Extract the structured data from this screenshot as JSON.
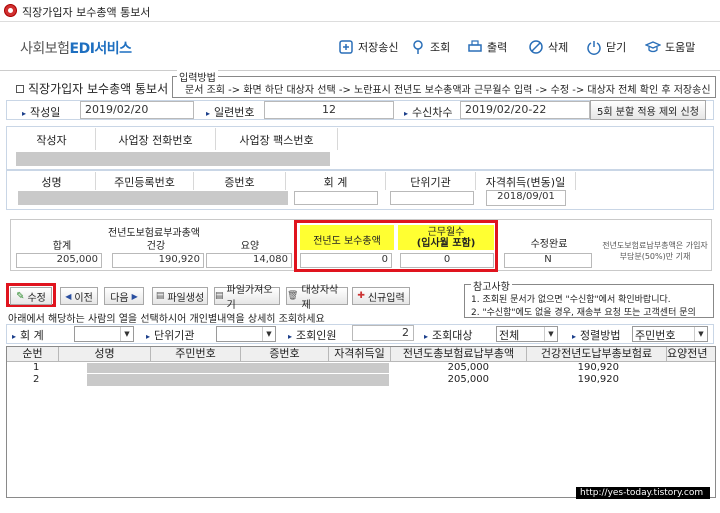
{
  "window": {
    "title": "직장가입자 보수총액 통보서"
  },
  "brand": {
    "name": "사회보험",
    "accent": "EDI서비스"
  },
  "toolbar": [
    {
      "label": "저장송신",
      "icon": "save-send-icon"
    },
    {
      "label": "조회",
      "icon": "location-pin-icon"
    },
    {
      "label": "출력",
      "icon": "printer-icon"
    },
    {
      "label": "삭제",
      "icon": "delete-icon"
    },
    {
      "label": "닫기",
      "icon": "power-icon"
    },
    {
      "label": "도움말",
      "icon": "graduation-cap-icon"
    }
  ],
  "form": {
    "title": "직장가입자 보수총액 통보서",
    "input_method_legend": "입력방법",
    "input_method_text": "문서 조회 -> 화면 하단 대상자 선택 -> 노란표시 전년도 보수총액과 근무월수 입력 -> 수정 -> 대상자 전체 확인 후 저장송신",
    "created_label": "작성일",
    "created_value": "2019/02/20",
    "serial_label": "일련번호",
    "serial_value": "12",
    "receive_label": "수신차수",
    "receive_value": "2019/02/20-22",
    "request_button": "5회 분할 적용 제외 신청"
  },
  "author": {
    "col1": "작성자",
    "col2": "사업장 전화번호",
    "col3": "사업장 팩스번호"
  },
  "person": {
    "name": "성명",
    "rrn": "주민등록번호",
    "cert": "증번호",
    "account": "회 계",
    "unit": "단위기관",
    "acquired": "자격취득(변동)일",
    "acquired_value": "2018/09/01"
  },
  "premium": {
    "title": "전년도보험료부과총액",
    "total_label": "합계",
    "total_value": "205,000",
    "health_label": "건강",
    "health_value": "190,920",
    "care_label": "요양",
    "care_value": "14,080",
    "pay_label": "전년도 보수총액",
    "pay_value": "0",
    "months_label": "근무월수",
    "months_sub": "(입사월 포함)",
    "months_value": "0",
    "done_label": "수정완료",
    "done_value": "N",
    "note": "전년도보험료납부총액은 가입자부담분(50%)만 기재"
  },
  "actions": {
    "edit": "수정",
    "prev": "이전",
    "next": "다음",
    "file_create": "파일생성",
    "file_import": "파일가져오기",
    "delete_target": "대상자삭제",
    "new_input": "신규입력"
  },
  "notes": {
    "legend": "참고사항",
    "line1": "1. 조회된 문서가 없으면 \"수신함\"에서 확인바랍니다.",
    "line2": "2. \"수신함\"에도 없을 경우, 재송부 요청 또는 고객센터 문의"
  },
  "instruction": "아래에서 해당하는 사람의 열을 선택하시어 개인별내역을 상세히 조회하세요",
  "filters": {
    "account_label": "회 계",
    "unit_label": "단위기관",
    "count_label": "조회인원",
    "count_value": "2",
    "target_label": "조회대상",
    "target_value": "전체",
    "sort_label": "정렬방법",
    "sort_value": "주민번호"
  },
  "grid": {
    "headers": [
      "순번",
      "성명",
      "주민번호",
      "증번호",
      "자격취득일",
      "전년도총보험료납부총액",
      "건강전년도납부총보험료",
      "요양전년"
    ],
    "rows": [
      {
        "no": "1",
        "total": "205,000",
        "health": "190,920"
      },
      {
        "no": "2",
        "total": "205,000",
        "health": "190,920"
      }
    ]
  },
  "watermark": "http://yes-today.tistory.com"
}
